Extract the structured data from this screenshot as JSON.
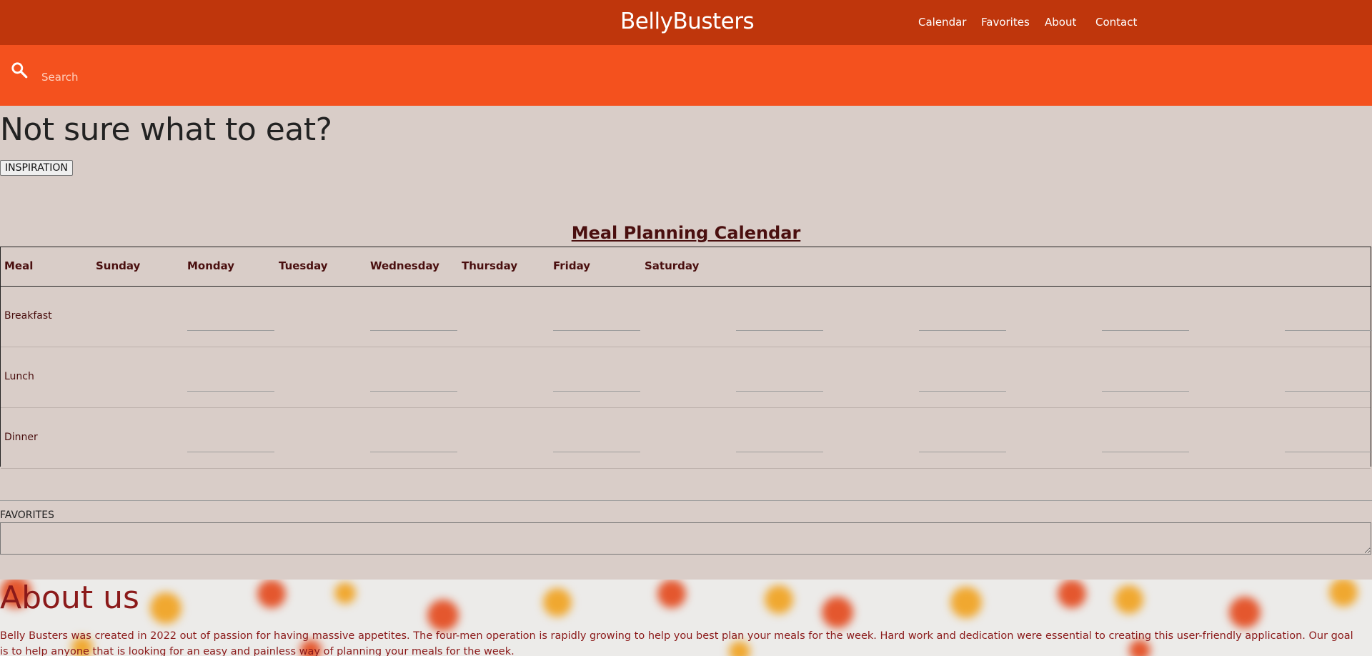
{
  "header": {
    "brand": "BellyBusters",
    "nav": [
      "Calendar",
      "Favorites",
      "About",
      "Contact"
    ]
  },
  "search": {
    "placeholder": "Search"
  },
  "hero": {
    "title": "Not sure what to eat?",
    "button": "INSPIRATION"
  },
  "calendar": {
    "title": "Meal Planning Calendar",
    "headers": [
      "Meal",
      "Sunday",
      "Monday",
      "Tuesday",
      "Wednesday",
      "Thursday",
      "Friday",
      "Saturday"
    ],
    "rows": [
      "Breakfast",
      "Lunch",
      "Dinner"
    ]
  },
  "favorites": {
    "label": "FAVORITES"
  },
  "about": {
    "title": "About us",
    "text": "Belly Busters was created in 2022 out of passion for having massive appetites. The four-men operation is rapidly growing to help you best plan your meals for the week. Hard work and dedication were essential to creating this user-friendly application. Our goal is to help anyone that is looking for an easy and painless way of planning your meals for the week."
  },
  "colors": {
    "header": "#bf360c",
    "searchbar": "#f4511e",
    "page": "#d9cdc8",
    "accent_text": "#4a0f0f"
  }
}
